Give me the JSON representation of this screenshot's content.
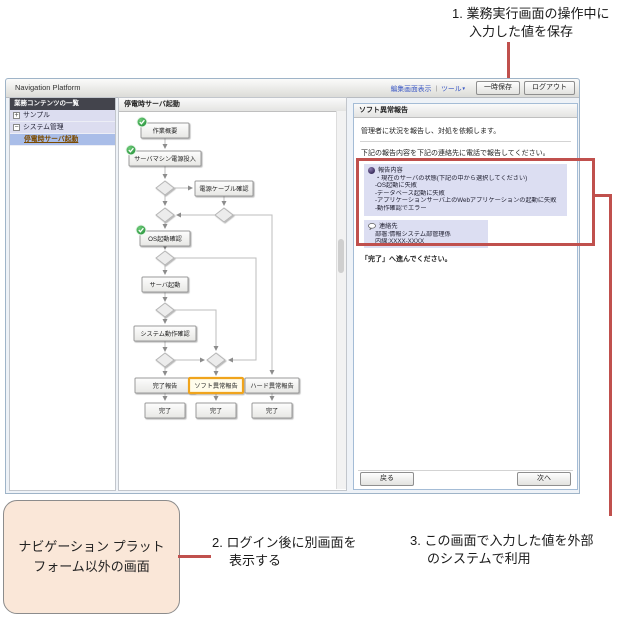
{
  "colors": {
    "callout": "#c0504d",
    "node_highlight": "#f0a41e"
  },
  "annotations": {
    "note1": {
      "line1": "1. 業務実行画面の操作中に",
      "line2": "入力した値を保存"
    },
    "note2": {
      "line1": "2. ログイン後に別画面を",
      "line2": "表示する"
    },
    "note3": {
      "line1": "3. この画面で入力した値を外部",
      "line2": "のシステムで利用"
    },
    "external_screen_box": {
      "line1": "ナビゲーション プラット",
      "line2": "フォーム以外の画面"
    }
  },
  "window": {
    "title": "Navigation Platform",
    "toolbar": {
      "edit_link": "編集画面表示",
      "separator": "|",
      "tools_label": "ツール",
      "tools_arrow": "▼",
      "save_button": "一時保存",
      "logout_button": "ログアウト"
    },
    "sidebar": {
      "header": "業務コンテンツの一覧",
      "items": [
        {
          "toggle": "+",
          "label": "サンプル"
        },
        {
          "toggle": "−",
          "label": "システム管理"
        },
        {
          "toggle": "",
          "label": "停電時サーバ起動"
        }
      ]
    },
    "flow_panel": {
      "header": "停電時サーバ起動"
    },
    "flowchart": {
      "overview": "作業概要",
      "power_on": "サーバマシン電源投入",
      "cable_check": "電源ケーブル確認",
      "os_check": "OS起動確認",
      "server_start": "サーバ起動",
      "system_check": "システム動作確認",
      "done_report": "完了報告",
      "soft_error_report": "ソフト異常報告",
      "hard_error_report": "ハード異常報告",
      "done": "完了"
    },
    "detail_panel": {
      "header": "ソフト異常報告",
      "intro": "管理者に状況を報告し、対処を依頼します。",
      "instruction": "下記の報告内容を下記の連絡先に電話で報告してください。",
      "report_box": {
        "title": "報告内容",
        "lines": [
          "・現在のサーバの状態(下記の中から選択してください)",
          "-OS起動に失敗",
          "-データベース起動に失敗",
          "-アプリケーションサーバ上のWebアプリケーションの起動に失敗",
          "-動作確認でエラー"
        ]
      },
      "contact_box": {
        "title": "連絡先",
        "lines": [
          "部署:情報システム部管理係",
          "内線:XXXX-XXXX"
        ]
      },
      "footer_note": "「完了」へ進んでください。",
      "back_button": "戻る",
      "next_button": "次へ"
    }
  }
}
